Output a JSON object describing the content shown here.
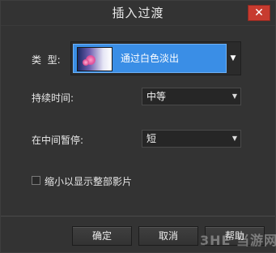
{
  "dialog": {
    "title": "插入过渡",
    "close_label": "✕"
  },
  "type_row": {
    "label": "类  型:",
    "selected_transition": "通过白色淡出",
    "arrow_icon": "▼"
  },
  "duration_row": {
    "label": "持续时间:",
    "value": "中等",
    "arrow_icon": "▼"
  },
  "pause_row": {
    "label": "在中间暂停:",
    "value": "短",
    "arrow_icon": "▼"
  },
  "shrink_option": {
    "label": "缩小以显示整部影片",
    "checked": false
  },
  "buttons": {
    "ok": "确定",
    "cancel": "取消",
    "help": "帮助"
  },
  "watermark": "3HE 当游网",
  "colors": {
    "background": "#333333",
    "close_button": "#c73b2f",
    "selection": "#3a8ee6"
  }
}
